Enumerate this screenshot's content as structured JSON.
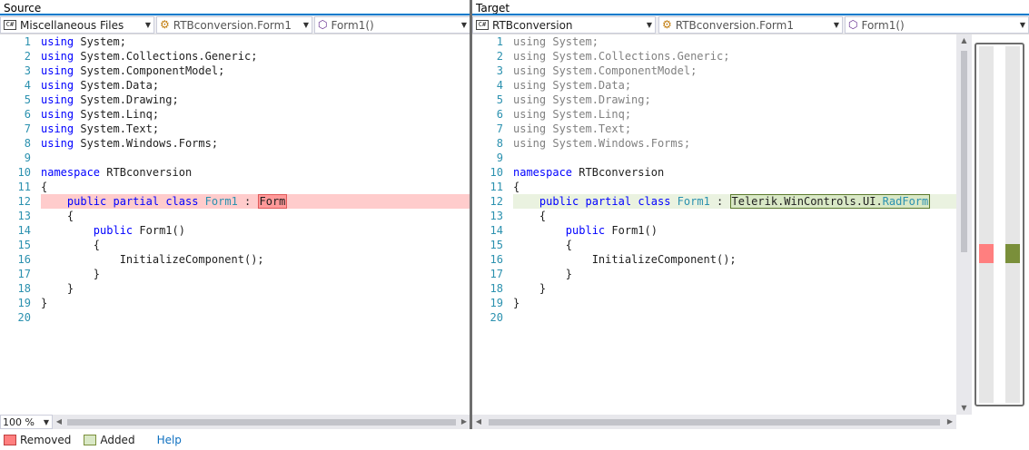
{
  "source": {
    "title": "Source",
    "nav": [
      "Miscellaneous Files",
      "RTBconversion.Form1",
      "Form1()"
    ],
    "zoom": "100 %"
  },
  "target": {
    "title": "Target",
    "nav": [
      "RTBconversion",
      "RTBconversion.Form1",
      "Form1()"
    ]
  },
  "line_numbers": [
    "1",
    "2",
    "3",
    "4",
    "5",
    "6",
    "7",
    "8",
    "9",
    "10",
    "11",
    "12",
    "13",
    "14",
    "15",
    "16",
    "17",
    "18",
    "19",
    "20"
  ],
  "code": {
    "using_kw": "using",
    "usings": [
      "System;",
      "System.Collections.Generic;",
      "System.ComponentModel;",
      "System.Data;",
      "System.Drawing;",
      "System.Linq;",
      "System.Text;",
      "System.Windows.Forms;"
    ],
    "namespace_kw": "namespace",
    "namespace_name": "RTBconversion",
    "open_brace": "{",
    "close_brace": "}",
    "public_kw": "public",
    "partial_kw": "partial",
    "class_kw": "class",
    "class_name": "Form1",
    "colon": ":",
    "source_base": "Form",
    "target_base_prefix": "Telerik.WinControls.UI.",
    "target_base_type": "RadForm",
    "ctor": "Form1()",
    "init_call": "InitializeComponent();"
  },
  "legend": {
    "removed_label": "Removed",
    "added_label": "Added",
    "help_label": "Help"
  },
  "colors": {
    "removed": "#ff7f7f",
    "added": "#7a8f3a",
    "accent": "#007acc"
  }
}
